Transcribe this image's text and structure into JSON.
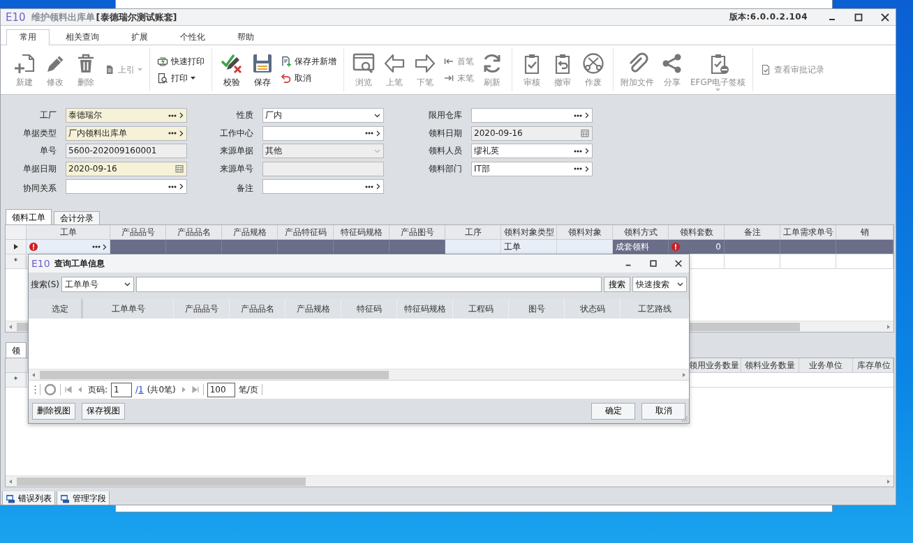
{
  "window": {
    "app_mark": "E10",
    "title": "维护领料出库单",
    "account": "[泰德瑞尔测试账套]",
    "version": "版本:6.0.0.2.104"
  },
  "ribbon_tabs": [
    {
      "label": "常用",
      "selected": true
    },
    {
      "label": "相关查询",
      "selected": false
    },
    {
      "label": "扩展",
      "selected": false
    },
    {
      "label": "个性化",
      "selected": false
    },
    {
      "label": "帮助",
      "selected": false
    }
  ],
  "toolbar": [
    {
      "items": [
        {
          "kind": "large",
          "label": "新建",
          "disabled": true,
          "menu": false
        },
        {
          "kind": "large",
          "label": "修改",
          "disabled": true,
          "menu": false
        },
        {
          "kind": "large",
          "label": "删除",
          "disabled": true,
          "menu": false
        },
        {
          "kind": "small",
          "label": "上引",
          "disabled": true,
          "menu": true
        }
      ]
    },
    {
      "items": [
        {
          "kind": "stack",
          "items": [
            {
              "kind": "small",
              "label": "快速打印",
              "disabled": false,
              "menu": false
            },
            {
              "kind": "small",
              "label": "打印",
              "disabled": false,
              "menu": true
            }
          ]
        }
      ]
    },
    {
      "items": [
        {
          "kind": "large",
          "label": "校验",
          "disabled": false,
          "menu": false
        },
        {
          "kind": "large",
          "label": "保存",
          "disabled": false,
          "menu": false
        },
        {
          "kind": "stack",
          "items": [
            {
              "kind": "small",
              "label": "保存并新增",
              "disabled": false,
              "menu": false
            },
            {
              "kind": "small",
              "label": "取消",
              "disabled": false,
              "menu": false
            }
          ]
        }
      ]
    },
    {
      "items": [
        {
          "kind": "large",
          "label": "浏览",
          "disabled": true,
          "menu": false
        },
        {
          "kind": "large",
          "label": "上笔",
          "disabled": true,
          "menu": false
        },
        {
          "kind": "large",
          "label": "下笔",
          "disabled": true,
          "menu": false
        },
        {
          "kind": "stack",
          "items": [
            {
              "kind": "small",
              "label": "首笔",
              "disabled": true,
              "menu": false
            },
            {
              "kind": "small",
              "label": "末笔",
              "disabled": true,
              "menu": false
            }
          ]
        },
        {
          "kind": "large",
          "label": "刷新",
          "disabled": true,
          "menu": false
        }
      ]
    },
    {
      "items": [
        {
          "kind": "large",
          "label": "审核",
          "disabled": true,
          "menu": false
        },
        {
          "kind": "large",
          "label": "撤审",
          "disabled": true,
          "menu": false
        },
        {
          "kind": "large",
          "label": "作废",
          "disabled": true,
          "menu": false
        }
      ]
    },
    {
      "items": [
        {
          "kind": "large",
          "label": "附加文件",
          "disabled": true,
          "menu": false
        },
        {
          "kind": "large",
          "label": "分享",
          "disabled": true,
          "menu": false
        },
        {
          "kind": "large",
          "label": "EFGP电子签核",
          "disabled": true,
          "menu": true
        }
      ]
    },
    {
      "items": [
        {
          "kind": "small",
          "label": "查看审批记录",
          "disabled": true,
          "menu": false
        }
      ]
    }
  ],
  "form": {
    "columns": [
      [
        {
          "label": "工厂",
          "kind": "lookup",
          "value": "泰德瑞尔",
          "required": true,
          "disabled": false
        },
        {
          "label": "单据类型",
          "kind": "lookup",
          "value": "厂内领料出库单",
          "required": true,
          "disabled": false
        },
        {
          "label": "单号",
          "kind": "text",
          "value": "5600-202009160001",
          "required": false,
          "disabled": true
        },
        {
          "label": "单据日期",
          "kind": "date",
          "value": "2020-09-16",
          "required": true,
          "disabled": false
        },
        {
          "label": "协同关系",
          "kind": "lookup",
          "required": false,
          "disabled": false
        }
      ],
      [
        {
          "label": "性质",
          "kind": "select",
          "value": "厂内",
          "required": false,
          "disabled": false
        },
        {
          "label": "工作中心",
          "kind": "lookup",
          "required": false,
          "disabled": false
        },
        {
          "label": "来源单据",
          "kind": "select",
          "value": "其他",
          "required": false,
          "disabled": true
        },
        {
          "label": "来源单号",
          "kind": "text",
          "required": false,
          "disabled": true
        },
        {
          "label": "备注",
          "kind": "lookup",
          "required": false,
          "disabled": false
        }
      ],
      [
        {
          "label": "限用仓库",
          "kind": "lookup",
          "required": false,
          "disabled": false
        },
        {
          "label": "领料日期",
          "kind": "date",
          "value": "2020-09-16",
          "required": false,
          "disabled": true
        },
        {
          "label": "领料人员",
          "kind": "lookup",
          "value": "缪礼英",
          "required": false,
          "disabled": false
        },
        {
          "label": "领料部门",
          "kind": "lookup",
          "value": "IT部",
          "required": false,
          "disabled": false
        }
      ]
    ]
  },
  "detail_tabs": [
    {
      "label": "领料工单",
      "selected": true
    },
    {
      "label": "会计分录",
      "selected": false
    }
  ],
  "detail_grid": {
    "columns": [
      "工单",
      "产品品号",
      "产品品名",
      "产品规格",
      "产品特征码",
      "特征码规格",
      "产品图号",
      "工序",
      "领料对象类型",
      "领料对象",
      "领料方式",
      "领料套数",
      "备注",
      "工单需求单号",
      "销"
    ],
    "rows": [
      {
        "kind": "current",
        "cells": [
          {
            "editable": true,
            "error": true,
            "lookup": true
          },
          {
            "editable": false
          },
          {
            "editable": false
          },
          {
            "editable": false
          },
          {
            "editable": false
          },
          {
            "editable": false
          },
          {
            "editable": false
          },
          {
            "editable": true
          },
          {
            "editable": true,
            "text": "工单"
          },
          {
            "editable": true
          },
          {
            "editable": false,
            "text": "成套领料"
          },
          {
            "editable": false,
            "error": true,
            "text": "0",
            "numeric": true
          },
          {
            "editable": false
          },
          {
            "editable": false
          },
          {
            "editable": false
          }
        ]
      },
      {
        "kind": "new",
        "marker": "*"
      }
    ]
  },
  "lower_tabs": [
    {
      "label": "领",
      "selected": true
    }
  ],
  "lower_grid": {
    "columns": [
      "领用业务数量",
      "领料业务数量",
      "业务单位",
      "库存单位"
    ],
    "rows": [
      {
        "kind": "new",
        "marker": "*"
      }
    ]
  },
  "bottom_tabs": [
    {
      "label": "错误列表"
    },
    {
      "label": "管理字段"
    }
  ],
  "dialog": {
    "app_mark": "E10",
    "title": "查询工单信息",
    "search_label": "搜索(S)",
    "search_field": "工单单号",
    "search_button": "搜索",
    "mode_select": "快速搜索",
    "columns": [
      "选定",
      "工单单号",
      "产品品号",
      "产品品名",
      "产品规格",
      "特征码",
      "特征码规格",
      "工程码",
      "图号",
      "状态码",
      "工艺路线"
    ],
    "pager": {
      "page_label": "页码:",
      "page": "1",
      "separator": "/",
      "total_pages": "1",
      "summary": "(共0笔)",
      "page_size": "100",
      "page_size_unit": "笔/页"
    },
    "buttons_left": [
      "删除视图",
      "保存视图"
    ],
    "buttons_right": [
      "确定",
      "取消"
    ]
  }
}
